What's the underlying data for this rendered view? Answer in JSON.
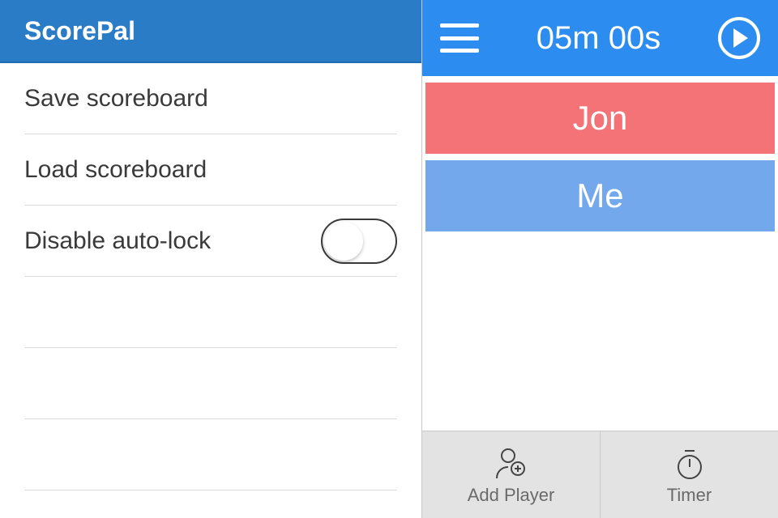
{
  "app": {
    "title": "ScorePal"
  },
  "menu": {
    "items": [
      {
        "label": "Save scoreboard"
      },
      {
        "label": "Load scoreboard"
      },
      {
        "label": "Disable auto-lock",
        "toggle": false
      }
    ]
  },
  "timer": {
    "display": "05m 00s"
  },
  "players": [
    {
      "name": "Jon",
      "color": "#f47377"
    },
    {
      "name": "Me",
      "color": "#73a8ed"
    }
  ],
  "bottom": {
    "add_player_label": "Add Player",
    "timer_label": "Timer"
  }
}
